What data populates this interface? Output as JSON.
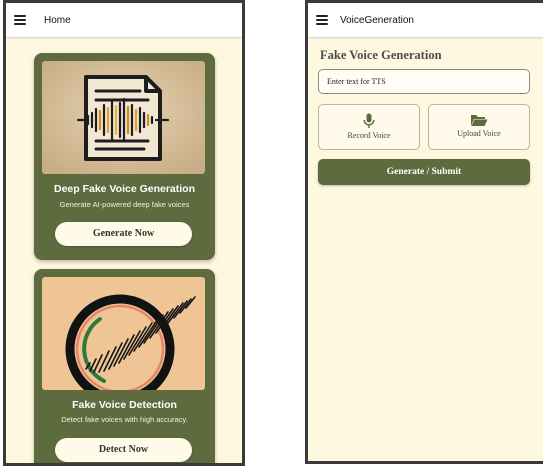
{
  "home_screen": {
    "title": "Home",
    "cards": [
      {
        "title": "Deep Fake Voice Generation",
        "description": "Generate AI-powered deep fake voices",
        "button": "Generate Now",
        "image_icon": "audio-document-icon"
      },
      {
        "title": "Fake Voice Detection",
        "description": "Detect fake voices with high accuracy.",
        "button": "Detect Now",
        "image_icon": "voice-detection-icon"
      }
    ]
  },
  "voice_generation_screen": {
    "title": "VoiceGeneration",
    "section_title": "Fake Voice Generation",
    "input_placeholder": "Enter text for TTS",
    "record_button": "Record Voice",
    "upload_button": "Upload Voice",
    "submit_button": "Generate / Submit",
    "icons": [
      "menu-icon",
      "microphone-icon",
      "folder-open-icon"
    ]
  },
  "colors": {
    "accent": "#5e6b3f",
    "background": "#fff8e1",
    "button_light": "#fffbe8"
  }
}
